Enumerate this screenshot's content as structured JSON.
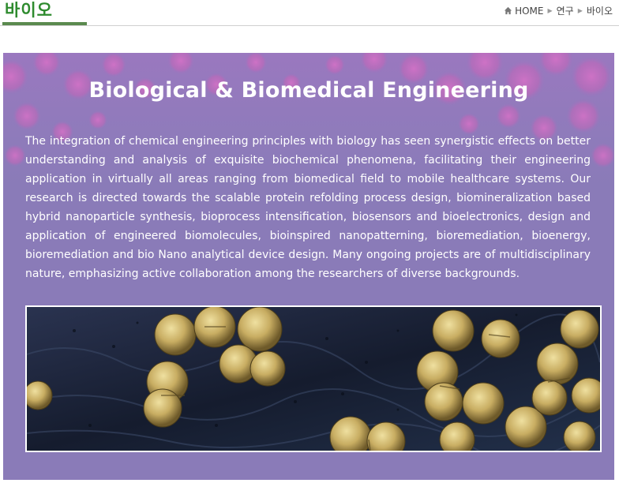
{
  "header": {
    "title": "바이오",
    "breadcrumb": [
      "HOME",
      "연구",
      "바이오"
    ]
  },
  "hero": {
    "title": "Biological & Biomedical Engineering",
    "description": "The integration of chemical engineering principles with biology has seen synergistic effects on better understanding and analysis of exquisite biochemical phenomena, facilitating their engineering application in virtually all areas ranging from biomedical field to mobile healthcare systems. Our research is directed towards the scalable protein refolding process design, biomineralization based hybrid nanoparticle synthesis, bioprocess intensification, biosensors and bioelectronics, design and application of engineered biomolecules, bioinspired nanopatterning, bioremediation, bioenergy, bioremediation and bio Nano analytical device design. Many ongoing projects are of multidisciplinary nature, emphasizing active collaboration among the researchers of diverse backgrounds."
  },
  "colors": {
    "title_green": "#2e8b2e",
    "hero_purple": "#8a7bb8",
    "bubble_pink": "#d06ab8",
    "bacteria_tan": "#c9b06a"
  },
  "icons": {
    "home": "home-icon",
    "separator": "triangle-right-icon"
  }
}
